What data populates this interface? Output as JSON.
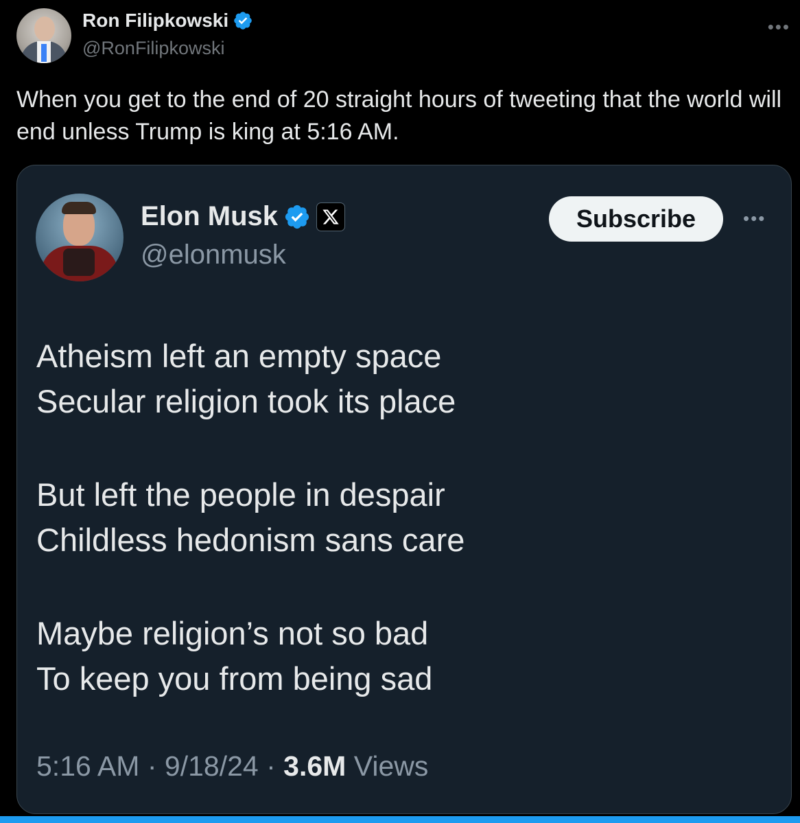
{
  "author": {
    "name": "Ron Filipkowski",
    "handle": "@RonFilipkowski",
    "verified": true
  },
  "tweet": {
    "text": "When you get to the end of 20 straight hours of tweeting that the world will end unless Trump is king at 5:16 AM."
  },
  "quoted": {
    "name": "Elon Musk",
    "handle": "@elonmusk",
    "verified": true,
    "subscribe_label": "Subscribe",
    "stanzas": [
      [
        "Atheism left an empty space",
        "Secular religion took its place"
      ],
      [
        "But left the people in despair",
        "Childless hedonism sans care"
      ],
      [
        "Maybe religion’s not so bad",
        "To keep you from being sad"
      ]
    ],
    "time": "5:16 AM",
    "date": "9/18/24",
    "separator": "·",
    "views_count": "3.6M",
    "views_label": "Views"
  },
  "more_glyph": "•••",
  "x_glyph": "𝕏",
  "colors": {
    "background": "#000000",
    "card_background": "#15202b",
    "verified_blue": "#1d9bf0",
    "muted_text": "#71767b"
  },
  "icons": {
    "verified": "verified-badge-icon",
    "more": "more-options-icon",
    "x_logo": "x-logo-icon"
  }
}
